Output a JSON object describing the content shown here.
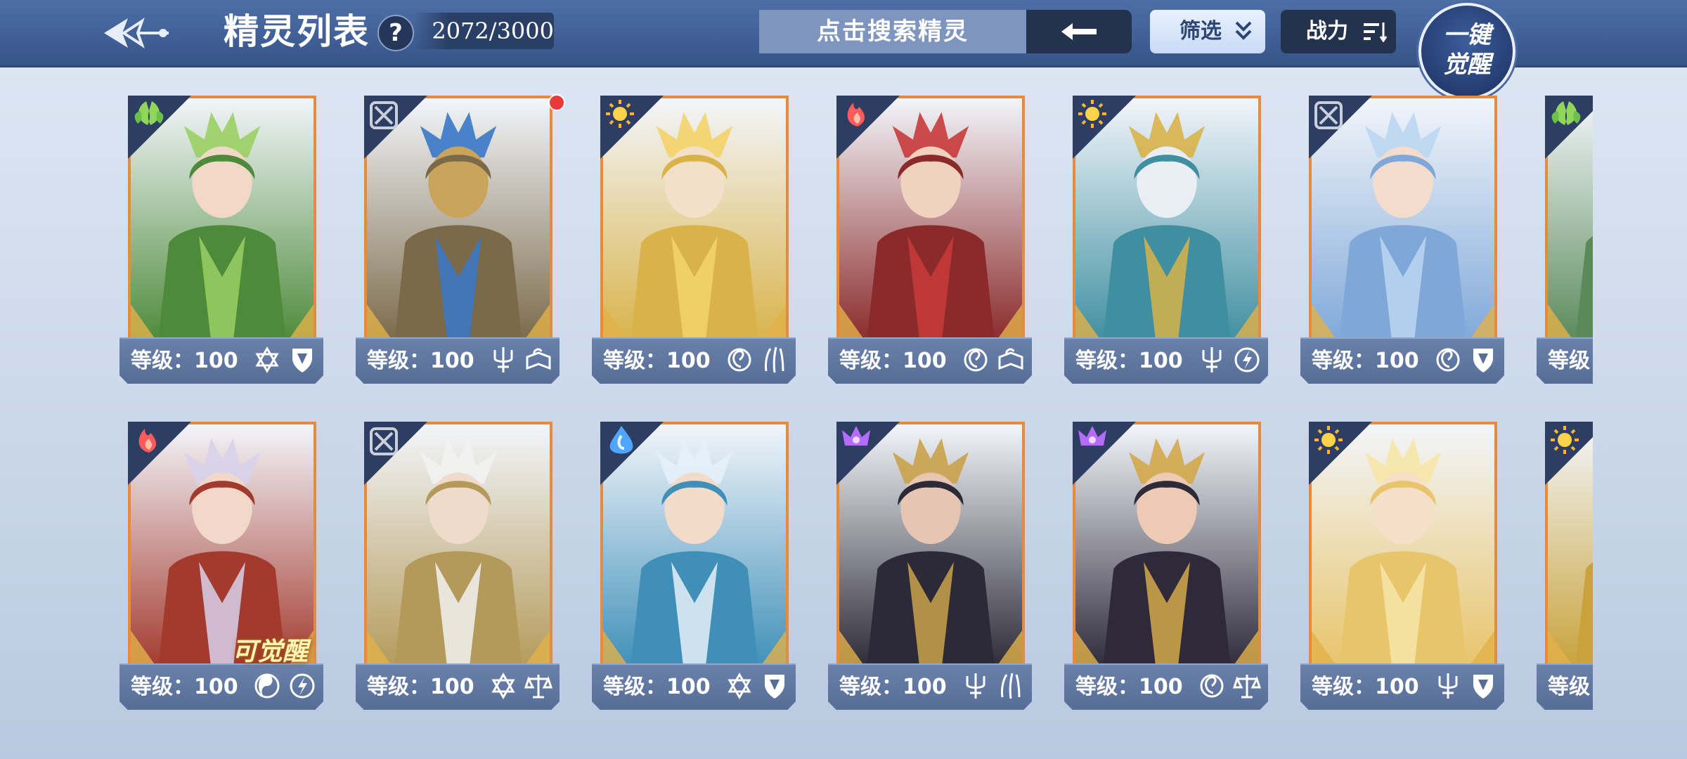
{
  "header": {
    "title": "精灵列表",
    "help_label": "?",
    "count": "2072/3000",
    "search_placeholder": "点击搜索精灵",
    "filter_label": "筛选",
    "sort_label": "战力",
    "awaken_line1": "一键",
    "awaken_line2": "觉醒"
  },
  "colors": {
    "frame_orange": "#e78a3b",
    "topbar": "#3f5f95",
    "bar": "#5f76a0",
    "notify_red": "#e9393b"
  },
  "cards": [
    {
      "level_text": "等级：100",
      "element": "grass-icon",
      "bg": "#4d8a3a",
      "accent": "#9ad064",
      "skin": "#f2d8c6",
      "icons": [
        "hexagram-icon",
        "shield-icon"
      ]
    },
    {
      "level_text": "等级：100",
      "element": "neutral-icon",
      "bg": "#7b6a4a",
      "accent": "#3a78c8",
      "skin": "#c9a45a",
      "icons": [
        "trident-icon",
        "book-icon"
      ],
      "notify": true
    },
    {
      "level_text": "等级：100",
      "element": "light-icon",
      "bg": "#d9b34a",
      "accent": "#f3d36a",
      "skin": "#f4dfc8",
      "icons": [
        "swirl-icon",
        "claw-icon"
      ]
    },
    {
      "level_text": "等级：100",
      "element": "fire-icon",
      "bg": "#8a2a2a",
      "accent": "#c83a3a",
      "skin": "#f0d2be",
      "icons": [
        "swirl-icon",
        "book-icon"
      ]
    },
    {
      "level_text": "等级：100",
      "element": "light-icon",
      "bg": "#3f8fa0",
      "accent": "#d9b34a",
      "skin": "#e8eef4",
      "icons": [
        "trident-icon",
        "lightning-icon"
      ]
    },
    {
      "level_text": "等级：100",
      "element": "neutral-icon",
      "bg": "#7fa8d8",
      "accent": "#bcd6f2",
      "skin": "#f4dccc",
      "icons": [
        "swirl-icon",
        "shield-icon"
      ]
    },
    {
      "level_text": "等级：100",
      "element": "fire-icon",
      "bg": "#a33a2e",
      "accent": "#d8d2ea",
      "skin": "#f2d8c8",
      "icons": [
        "yinyang-icon",
        "lightning-icon"
      ],
      "badge": "可觉醒"
    },
    {
      "level_text": "等级：100",
      "element": "neutral-icon",
      "bg": "#b49a5a",
      "accent": "#f2f2f2",
      "skin": "#f0dacc",
      "icons": [
        "hexagram-icon",
        "scales-icon"
      ]
    },
    {
      "level_text": "等级：100",
      "element": "water-icon",
      "bg": "#3f8fb8",
      "accent": "#e6f0f8",
      "skin": "#f3dbc9",
      "icons": [
        "hexagram-icon",
        "shield-icon"
      ]
    },
    {
      "level_text": "等级：100",
      "element": "dark-icon",
      "bg": "#2c2a36",
      "accent": "#c9a24a",
      "skin": "#e6c6b2",
      "icons": [
        "trident-icon",
        "claw-icon"
      ]
    },
    {
      "level_text": "等级：100",
      "element": "dark-icon",
      "bg": "#2e2a3a",
      "accent": "#d3a94a",
      "skin": "#eccab4",
      "icons": [
        "swirl-icon",
        "scales-icon"
      ]
    },
    {
      "level_text": "等级：100",
      "element": "light-icon",
      "bg": "#e8c46a",
      "accent": "#f6e6a8",
      "skin": "#f6dfc8",
      "icons": [
        "trident-icon",
        "shield-icon"
      ]
    }
  ],
  "partial_cards": [
    {
      "level_text": "等级：",
      "element": "grass-icon",
      "bg": "#5a8a5a"
    },
    {
      "level_text": "等级：",
      "element": "light-icon",
      "bg": "#c8a23a"
    }
  ]
}
